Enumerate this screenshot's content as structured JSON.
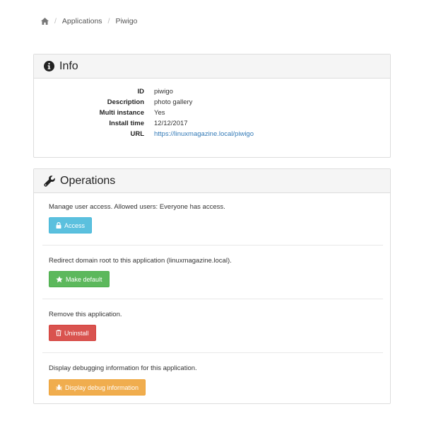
{
  "breadcrumb": {
    "items": [
      "Applications",
      "Piwigo"
    ]
  },
  "info": {
    "title": "Info",
    "rows": [
      {
        "key": "ID",
        "value": "piwigo"
      },
      {
        "key": "Description",
        "value": "photo gallery"
      },
      {
        "key": "Multi instance",
        "value": "Yes"
      },
      {
        "key": "Install time",
        "value": "12/12/2017"
      },
      {
        "key": "URL",
        "value": "https://linuxmagazine.local/piwigo"
      }
    ]
  },
  "operations": {
    "title": "Operations",
    "items": [
      {
        "text": "Manage user access. Allowed users: Everyone has access.",
        "button": "Access",
        "color": "#5bc0de"
      },
      {
        "text": "Redirect domain root to this application (linuxmagazine.local).",
        "button": "Make default",
        "color": "#5cb85c"
      },
      {
        "text": "Remove this application.",
        "button": "Uninstall",
        "color": "#d9534f"
      },
      {
        "text": "Display debugging information for this application.",
        "button": "Display debug information",
        "color": "#f0ad4e"
      }
    ]
  }
}
